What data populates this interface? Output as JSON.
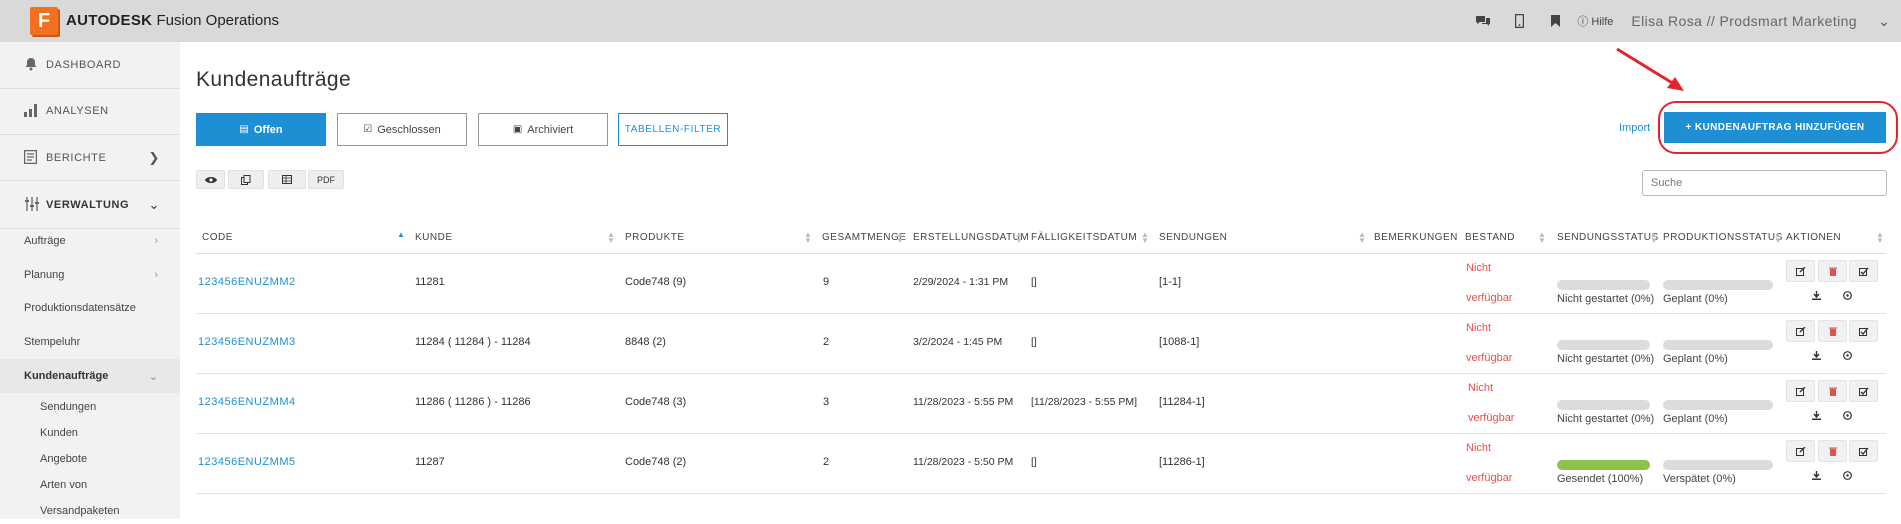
{
  "header": {
    "logo_letter": "F",
    "brand_bold": "AUTODESK",
    "brand_rest": "Fusion Operations",
    "help_label": "Hilfe",
    "user": "Elisa Rosa // Prodsmart Marketing"
  },
  "sidebar": {
    "main": [
      {
        "label": "DASHBOARD",
        "icon": "bell-icon"
      },
      {
        "label": "ANALYSEN",
        "icon": "bar-chart-icon"
      },
      {
        "label": "BERICHTE",
        "icon": "report-icon"
      },
      {
        "label": "VERWALTUNG",
        "icon": "sliders-icon"
      }
    ],
    "sub": [
      "Aufträge",
      "Planung",
      "Produktionsdatensätze",
      "Stempeluhr",
      "Kundenaufträge"
    ],
    "sub2": [
      "Sendungen",
      "Kunden",
      "Angebote",
      "Arten von",
      "Versandpaketen"
    ]
  },
  "page": {
    "title": "Kundenaufträge",
    "tabs": [
      "Offen",
      "Geschlossen",
      "Archiviert",
      "TABELLEN-FILTER"
    ],
    "tools": [
      "eye-icon",
      "copy-icon",
      "table-icon",
      "PDF"
    ],
    "import_label": "Import",
    "add_label": "+ KUNDENAUFTRAG HINZUFÜGEN",
    "search_placeholder": "Suche"
  },
  "table": {
    "columns": [
      "CODE",
      "KUNDE",
      "PRODUKTE",
      "GESAMTMENGE",
      "ERSTELLUNGSDATUM",
      "FÄLLIGKEITSDATUM",
      "SENDUNGEN",
      "BEMERKUNGEN",
      "BESTAND",
      "SENDUNGSSTATUS",
      "PRODUKTIONSSTATUS",
      "AKTIONEN"
    ],
    "rows": [
      {
        "code": "123456ENUZMM2",
        "kunde": "11281",
        "produkte": "Code748 (9)",
        "menge": "9",
        "erstellt": "2/29/2024 - 1:31 PM",
        "faellig": "[]",
        "sendungen": "[1-1]",
        "bestand1": "Nicht",
        "bestand2": "verfügbar",
        "sendungsstatus": "Nicht gestartet (0%)",
        "sendung_progress": 0,
        "produktionsstatus": "Geplant (0%)"
      },
      {
        "code": "123456ENUZMM3",
        "kunde": "11284 ( 11284 ) - 11284",
        "produkte": "8848 (2)",
        "menge": "2",
        "erstellt": "3/2/2024 - 1:45 PM",
        "faellig": "[]",
        "sendungen": "[1088-1]",
        "bestand1": "Nicht",
        "bestand2": "verfügbar",
        "sendungsstatus": "Nicht gestartet (0%)",
        "sendung_progress": 0,
        "produktionsstatus": "Geplant (0%)"
      },
      {
        "code": "123456ENUZMM4",
        "kunde": "11286 ( 11286 ) - 11286",
        "produkte": "Code748 (3)",
        "menge": "3",
        "erstellt": "11/28/2023 - 5:55 PM",
        "faellig": "[11/28/2023 - 5:55 PM]",
        "sendungen": "[11284-1]",
        "bestand1": "Nicht",
        "bestand2": "verfügbar",
        "sendungsstatus": "Nicht gestartet (0%)",
        "sendung_progress": 0,
        "produktionsstatus": "Geplant (0%)"
      },
      {
        "code": "123456ENUZMM5",
        "kunde": "11287",
        "produkte": "Code748 (2)",
        "menge": "2",
        "erstellt": "11/28/2023 - 5:50 PM",
        "faellig": "[]",
        "sendungen": "[11286-1]",
        "bestand1": "Nicht",
        "bestand2": "verfügbar",
        "sendungsstatus": "Gesendet (100%)",
        "sendung_progress": 100,
        "produktionsstatus": "Verspätet (0%)"
      }
    ]
  },
  "colors": {
    "accent": "#1e8fd5",
    "danger": "#e0524a",
    "success": "#8bc34a",
    "highlight": "#e0252d"
  }
}
